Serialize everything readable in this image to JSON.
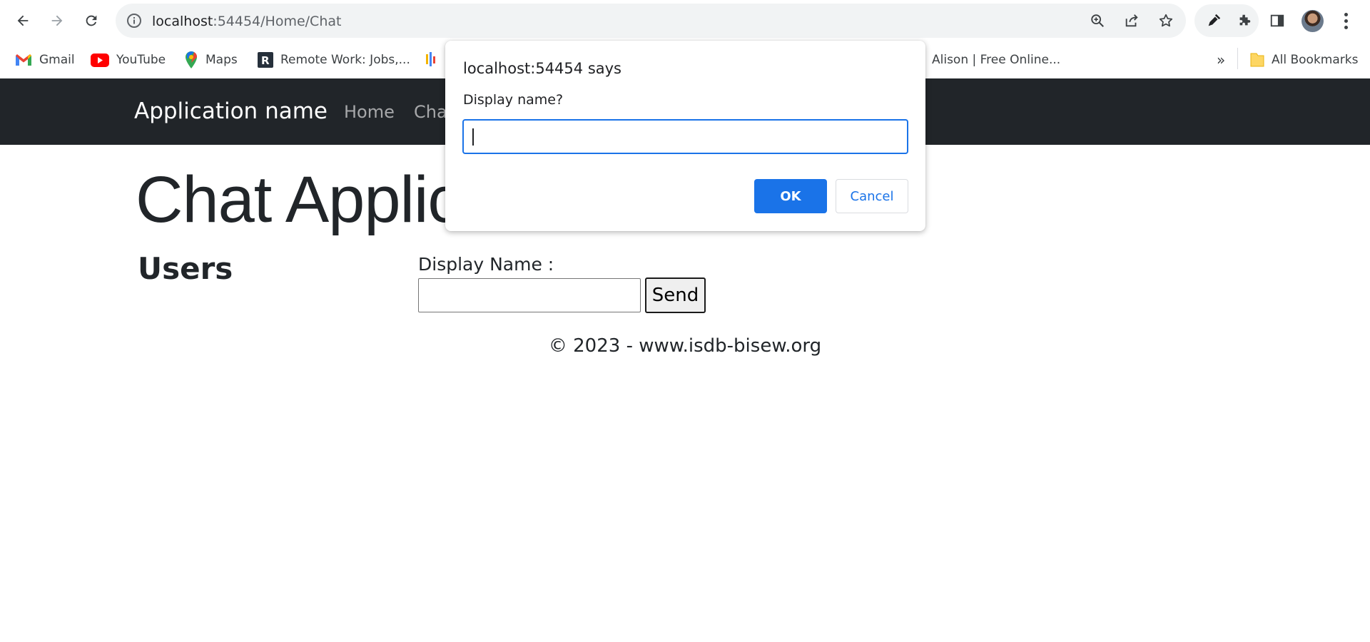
{
  "browser": {
    "url_host": "localhost",
    "url_rest": ":54454/Home/Chat",
    "bookmarks": [
      {
        "label": "Gmail",
        "icon": "gmail-icon"
      },
      {
        "label": "YouTube",
        "icon": "youtube-icon"
      },
      {
        "label": "Maps",
        "icon": "maps-icon"
      },
      {
        "label": "Remote Work: Jobs,...",
        "icon": "remote-work-icon"
      },
      {
        "label": "",
        "icon": "bookmark-icon"
      },
      {
        "label": "Alison | Free Online...",
        "icon": ""
      }
    ],
    "overflow_label": "»",
    "all_bookmarks_label": "All Bookmarks"
  },
  "app": {
    "brand": "Application name",
    "nav": [
      "Home",
      "Cha"
    ],
    "title": "Chat Applic",
    "users_heading": "Users",
    "display_name_label": "Display Name :",
    "send_label": "Send",
    "footer": "© 2023 - www.isdb-bisew.org"
  },
  "dialog": {
    "title": "localhost:54454 says",
    "message": "Display name?",
    "input_value": "",
    "ok_label": "OK",
    "cancel_label": "Cancel"
  },
  "colors": {
    "accent": "#1a73e8",
    "navbar": "#212529"
  }
}
